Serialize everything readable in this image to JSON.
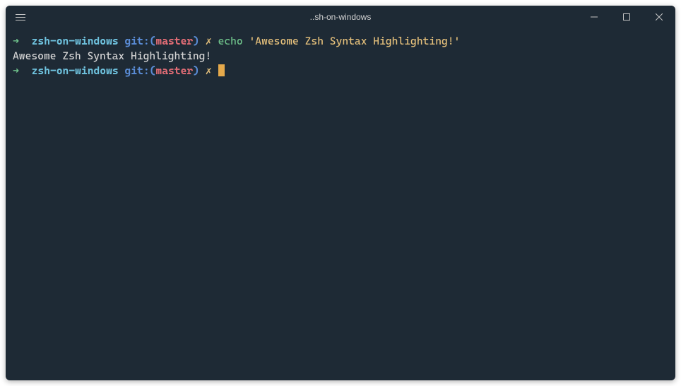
{
  "window": {
    "title": "..sh-on-windows"
  },
  "prompt": {
    "arrow": "➜",
    "dir": "zsh-on-windows",
    "git_label": "git:",
    "paren_open": "(",
    "branch": "master",
    "paren_close": ")",
    "dirty_mark": "✗"
  },
  "lines": {
    "l1_cmd": "echo",
    "l1_string": "'Awesome Zsh Syntax Highlighting!'",
    "l2_output": "Awesome Zsh Syntax Highlighting!"
  }
}
